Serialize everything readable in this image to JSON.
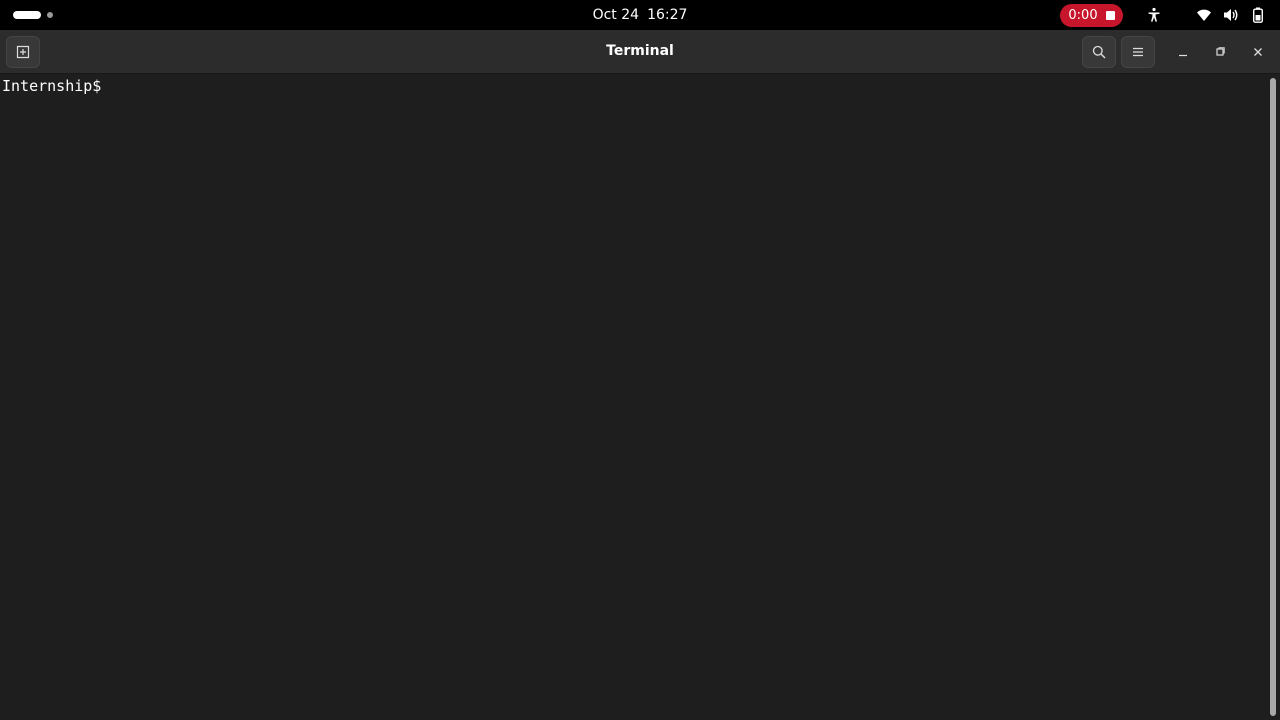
{
  "topbar": {
    "date": "Oct 24",
    "time": "16:27",
    "recording": {
      "elapsed": "0:00",
      "color": "#c7162b"
    },
    "tray_icons": [
      "accessibility-icon",
      "wifi-icon",
      "volume-icon",
      "battery-icon"
    ]
  },
  "window": {
    "title": "Terminal",
    "header_buttons": [
      "new-tab-icon",
      "search-icon",
      "menu-icon"
    ],
    "window_controls": [
      "minimize-icon",
      "maximize-icon",
      "close-icon"
    ]
  },
  "terminal": {
    "prompt": "Internship$ ",
    "input": ""
  }
}
